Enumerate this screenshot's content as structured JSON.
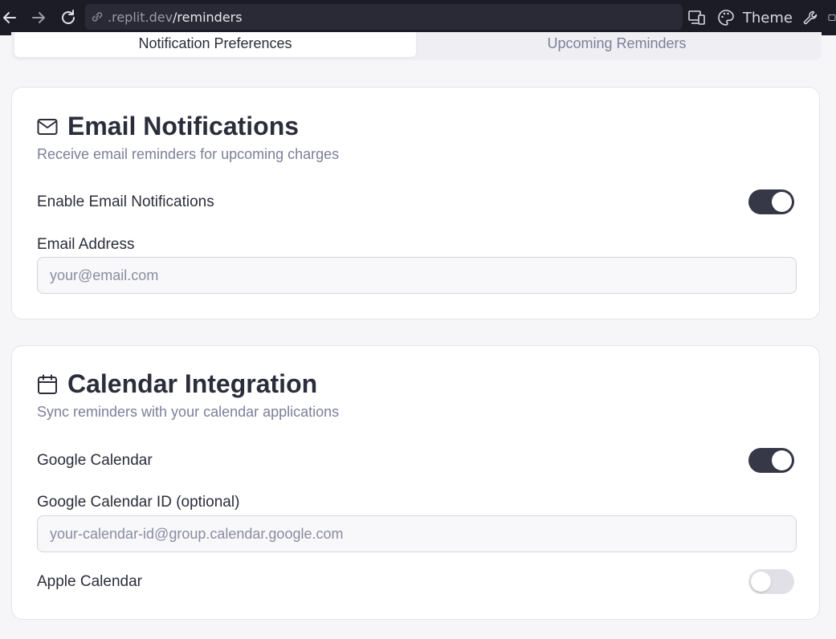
{
  "browser": {
    "url_prefix": ".replit.dev",
    "url_path": "/reminders",
    "theme_label": "Theme"
  },
  "tabs": [
    {
      "label": "Notification Preferences",
      "active": true
    },
    {
      "label": "Upcoming Reminders",
      "active": false
    }
  ],
  "email_card": {
    "title": "Email Notifications",
    "subtitle": "Receive email reminders for upcoming charges",
    "toggle_label": "Enable Email Notifications",
    "toggle_on": true,
    "field_label": "Email Address",
    "field_placeholder": "your@email.com",
    "field_value": ""
  },
  "calendar_card": {
    "title": "Calendar Integration",
    "subtitle": "Sync reminders with your calendar applications",
    "google_label": "Google Calendar",
    "google_on": true,
    "google_id_label": "Google Calendar ID (optional)",
    "google_id_placeholder": "your-calendar-id@group.calendar.google.com",
    "apple_label": "Apple Calendar",
    "apple_on": false
  },
  "colors": {
    "toggle_on": "#363848",
    "toggle_off": "#e0e0e6",
    "muted_text": "#7c7f9a"
  },
  "icons": [
    "back-arrow-icon",
    "forward-arrow-icon",
    "reload-icon",
    "link-icon",
    "devices-icon",
    "palette-icon",
    "wrench-icon",
    "mail-icon",
    "calendar-icon"
  ]
}
